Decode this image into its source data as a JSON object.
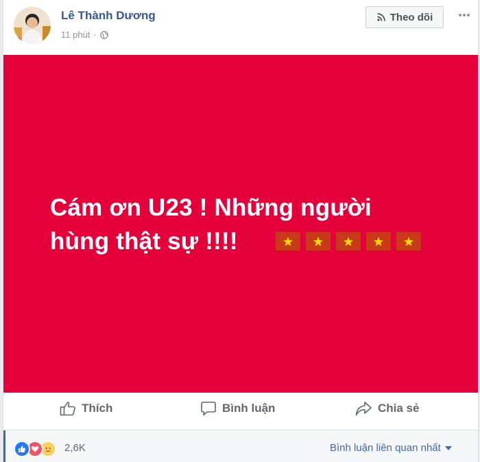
{
  "post": {
    "author": "Lê Thành Dương",
    "timestamp": "11 phút",
    "separator": "·",
    "privacy_icon": "globe-icon",
    "follow_label": "Theo dõi",
    "more_icon": "more-dots-icon"
  },
  "image": {
    "background_color": "#e4003a",
    "line1": "Cám ơn U23 ! Những người",
    "line2": "hùng thật sự !!!!",
    "star_count": 5,
    "star_tile_color": "#c93a19",
    "star_color": "#ffd400"
  },
  "actions": {
    "like_label": "Thích",
    "comment_label": "Bình luận",
    "share_label": "Chia sẻ"
  },
  "footer": {
    "reactions": [
      "like",
      "love",
      "sad"
    ],
    "reaction_count": "2,6K",
    "sort_label": "Bình luận liên quan nhất"
  },
  "colors": {
    "link_blue": "#365899",
    "accent_blue": "#4267b2",
    "muted_text": "#90949c",
    "action_text": "#606770"
  }
}
